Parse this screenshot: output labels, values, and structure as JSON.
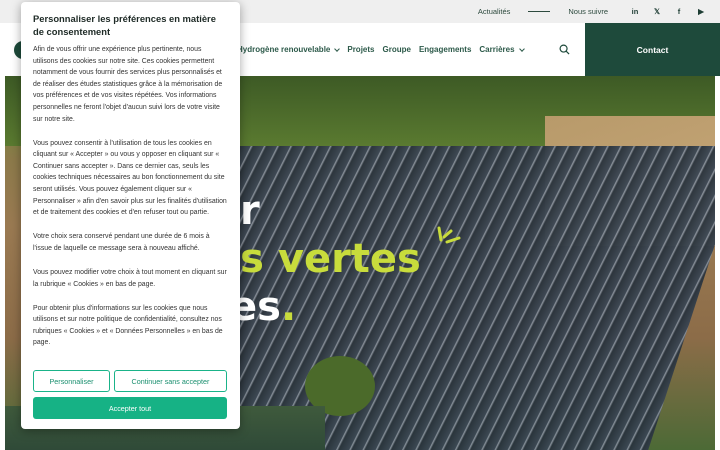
{
  "topbar": {
    "links": [
      "Actualités",
      "Nous suivre"
    ],
    "social": [
      "in",
      "𝕏",
      "f",
      "▶"
    ],
    "social_icons": [
      "linkedin-icon",
      "x-twitter-icon",
      "facebook-icon",
      "youtube-icon"
    ]
  },
  "nav": {
    "items": [
      {
        "label": "Hydrogène renouvelable",
        "has_menu": true
      },
      {
        "label": "Projets",
        "has_menu": false
      },
      {
        "label": "Groupe",
        "has_menu": false
      },
      {
        "label": "Engagements",
        "has_menu": false
      },
      {
        "label": "Carrières",
        "has_menu": true
      }
    ],
    "contact_label": "Contact"
  },
  "hero": {
    "line1": "r",
    "line2": "es vertes",
    "line3": "es",
    "line3_dot": "."
  },
  "cookie": {
    "title": "Personnaliser les préférences en matière de consentement",
    "paragraphs": [
      "Afin de vous offrir une expérience plus pertinente, nous utilisons des cookies sur notre site. Ces cookies permettent notamment de vous fournir des services plus personnalisés et de réaliser des études statistiques grâce à la mémorisation de vos préférences et de vos visites répétées. Vos informations personnelles ne feront l'objet d'aucun suivi lors de votre visite sur notre site.",
      "Vous pouvez consentir à l'utilisation de tous les cookies en cliquant sur « Accepter » ou vous y opposer en cliquant sur « Continuer sans accepter ». Dans ce dernier cas, seuls les cookies techniques nécessaires au bon fonctionnement du site seront utilisés. Vous pouvez également cliquer sur « Personnaliser » afin d'en savoir plus sur les finalités d'utilisation et de traitement des cookies et d'en refuser tout ou partie.",
      "Votre choix sera conservé pendant une durée de 6 mois à l'issue de laquelle ce message sera à nouveau affiché.",
      "Vous pouvez modifier votre choix à tout moment en cliquant sur la rubrique « Cookies » en bas de page.",
      "Pour obtenir plus d'informations sur les cookies que nous utilisons et sur notre politique de confidentialité, consultez nos rubriques « Cookies » et « Données Personnelles » en bas de page."
    ],
    "personalize_label": "Personnaliser",
    "continue_label": "Continuer sans accepter",
    "accept_label": "Accepter tout"
  },
  "colors": {
    "brand_dark_green": "#1e4a3b",
    "accent_teal": "#16b285",
    "headline_lime": "#c8dc3c"
  }
}
